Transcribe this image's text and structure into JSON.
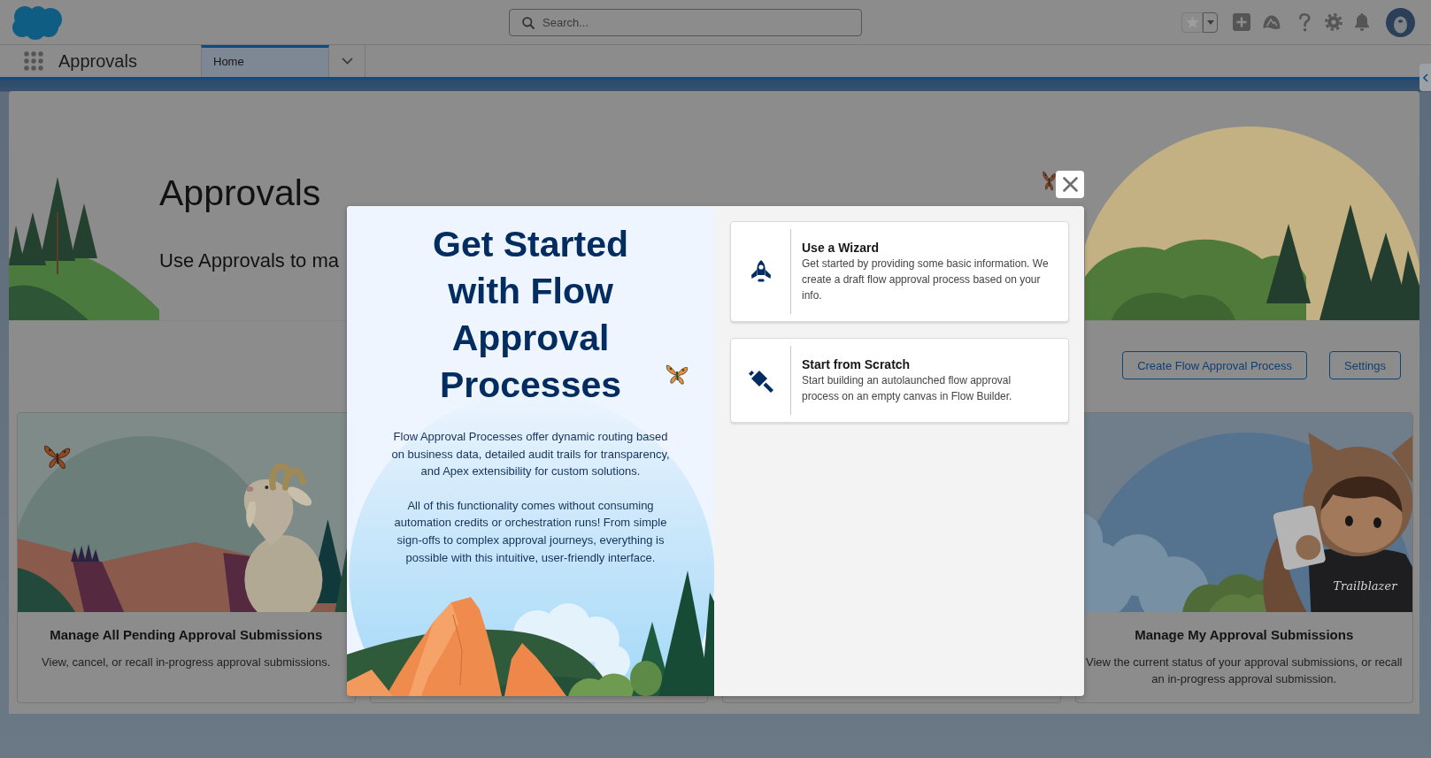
{
  "header": {
    "search": {
      "placeholder": "Search..."
    }
  },
  "nav": {
    "app_name": "Approvals",
    "tabs": [
      {
        "label": "Home",
        "selected": true
      }
    ]
  },
  "banner": {
    "title": "Approvals",
    "subtitle": "Use Approvals to ma"
  },
  "actions": [
    {
      "label": "Create Flow Approval Process"
    },
    {
      "label": "Settings"
    }
  ],
  "cards": [
    {
      "kind": "goat",
      "title": "Manage All Pending Approval Submissions",
      "description": "View, cancel, or recall in-progress approval submissions."
    },
    {
      "kind": "mascot",
      "title": "Manage My Approval Submissions",
      "description": "View the current status of your approval submissions, or recall an in-progress approval submission.",
      "art_text": "Trailblazer"
    }
  ],
  "modal": {
    "title": "Get Started with Flow Approval Processes",
    "paragraphs": [
      "Flow Approval Processes offer dynamic routing based on business data, detailed audit trails for transparency, and Apex extensibility for custom solutions.",
      "All of this functionality comes without consuming automation credits or orchestration runs! From simple sign-offs to complex approval journeys, everything is possible with this intuitive, user-friendly interface."
    ],
    "options": [
      {
        "kind": "wizard",
        "title": "Use a Wizard",
        "description": "Get started by providing some basic information. We create a draft flow approval process based on your info."
      },
      {
        "kind": "scratch",
        "title": "Start from Scratch",
        "description": "Start building an autolaunched flow approval process on an empty canvas in Flow Builder."
      }
    ]
  }
}
